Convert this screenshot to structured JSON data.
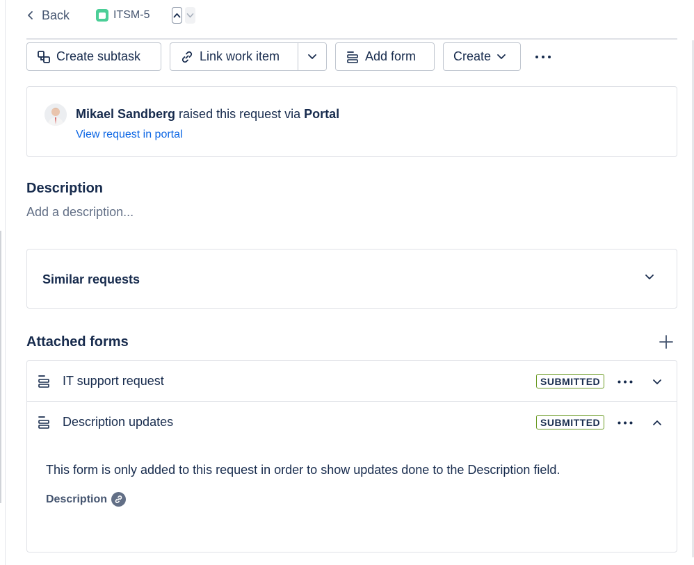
{
  "topbar": {
    "back_label": "Back",
    "issue_key": "ITSM-5"
  },
  "toolbar": {
    "create_subtask": "Create subtask",
    "link_work_item": "Link work item",
    "add_form": "Add form",
    "create": "Create"
  },
  "reporter": {
    "name": "Mikael Sandberg",
    "middle_text": " raised this request via ",
    "channel": "Portal",
    "portal_link": "View request in portal"
  },
  "description": {
    "title": "Description",
    "placeholder": "Add a description..."
  },
  "similar_requests": {
    "title": "Similar requests"
  },
  "attached_forms": {
    "title": "Attached forms",
    "forms": [
      {
        "name": "IT support request",
        "status": "SUBMITTED",
        "expanded": false
      },
      {
        "name": "Description updates",
        "status": "SUBMITTED",
        "expanded": true
      }
    ],
    "expanded_note": "This form is only added to this request in order to show updates done to the Description field.",
    "field_label": "Description"
  },
  "colors": {
    "link": "#0c66e4",
    "badge_border": "#6a9a23",
    "request_type": "#4bce97"
  }
}
